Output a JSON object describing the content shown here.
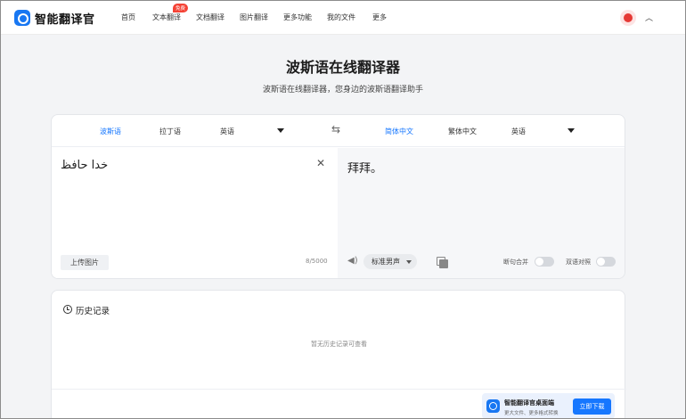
{
  "header": {
    "brand": "智能翻译官",
    "nav": [
      "首页",
      "文本翻译",
      "文档翻译",
      "图片翻译",
      "更多功能",
      "我的文件",
      "更多"
    ],
    "badge": "免费"
  },
  "page": {
    "title": "波斯语在线翻译器",
    "subtitle": "波斯语在线翻译器，您身边的波斯语翻译助手"
  },
  "translator": {
    "source_langs": [
      "波斯语",
      "拉丁语",
      "英语"
    ],
    "target_langs": [
      "简体中文",
      "繁体中文",
      "英语"
    ],
    "source_text": "خدا حافظ",
    "target_text": "拜拜。",
    "upload_label": "上传图片",
    "char_count": "8/5000",
    "voice": "标准男声",
    "merge_label": "断句合并",
    "bilingual_label": "双语对照",
    "merge_on": false,
    "bilingual_on": false,
    "accent_color": "#1677ff"
  },
  "history": {
    "title": "历史记录",
    "empty_text": "暂无历史记录可查看"
  },
  "download": {
    "title": "智能翻译官桌面端",
    "subtitle": "更大文件、更多格式转换",
    "button": "立即下载"
  }
}
